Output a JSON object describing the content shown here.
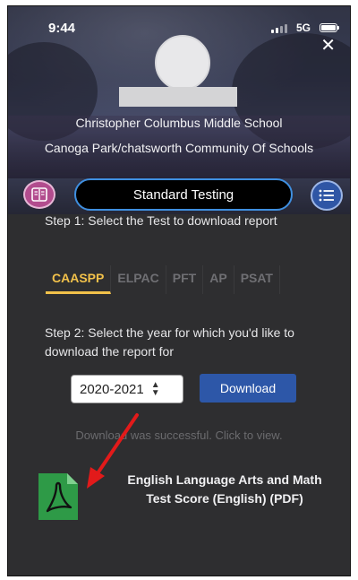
{
  "status_bar": {
    "time": "9:44",
    "network": "5G"
  },
  "header": {
    "school_name": "Christopher Columbus Middle School",
    "community": "Canoga Park/chatsworth Community Of Schools"
  },
  "toolbar": {
    "title": "Standard Testing",
    "left_icon": "book-icon",
    "right_icon": "list-icon"
  },
  "step1": {
    "label": "Step 1: Select the Test to download report",
    "tabs": [
      {
        "label": "CAASPP",
        "active": true
      },
      {
        "label": "ELPAC",
        "active": false
      },
      {
        "label": "PFT",
        "active": false
      },
      {
        "label": "AP",
        "active": false
      },
      {
        "label": "PSAT",
        "active": false
      }
    ]
  },
  "step2": {
    "label": "Step 2: Select the year for which you'd like to download the report for",
    "year_selected": "2020-2021",
    "download_label": "Download"
  },
  "result": {
    "message": "Download was successful. Click to view.",
    "file_label": "English Language Arts and Math Test Score (English) (PDF)",
    "file_icon": "pdf-icon"
  },
  "colors": {
    "accent": "#f2c14a",
    "primary": "#2d57a8",
    "pill_border": "#3f8fe0",
    "pdf_green": "#2e9a47",
    "arrow_red": "#e21a1a"
  }
}
